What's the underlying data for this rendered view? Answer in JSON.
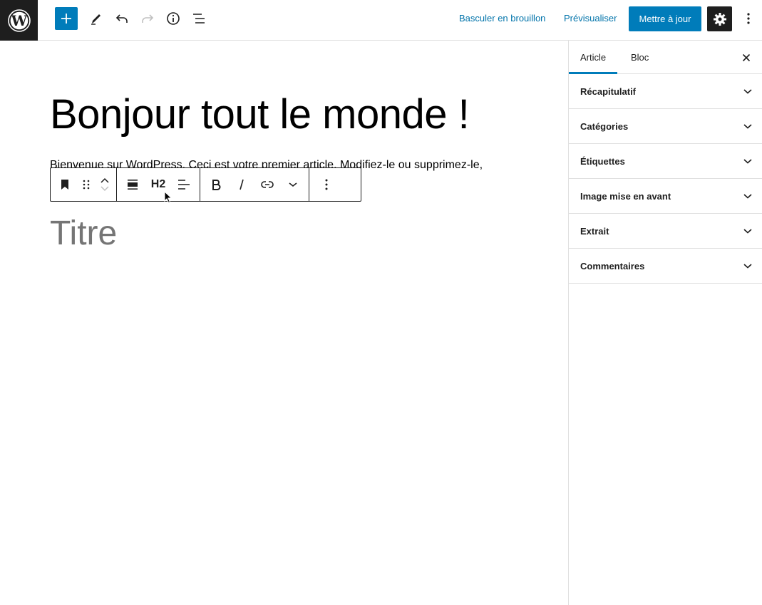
{
  "topbar": {
    "switch_draft_label": "Basculer en brouillon",
    "preview_label": "Prévisualiser",
    "update_label": "Mettre à jour",
    "icons": [
      "wordpress-logo",
      "plus-icon",
      "pencil-icon",
      "undo-icon",
      "redo-icon",
      "info-icon",
      "list-view-icon",
      "gear-icon",
      "more-vertical-icon"
    ]
  },
  "editor": {
    "post_title": "Bonjour tout le monde !",
    "paragraph": "Bienvenue sur WordPress. Ceci est votre premier article. Modifiez-le ou supprimez-le,",
    "heading_placeholder": "Titre",
    "toolbar": {
      "heading_level": "H2",
      "icons": [
        "bookmark-icon",
        "drag-handle-icon",
        "move-up-icon",
        "move-down-icon",
        "align-wide-icon",
        "text-align-left-icon",
        "bold-icon",
        "italic-icon",
        "link-icon",
        "chevron-down-icon",
        "more-options-icon"
      ]
    }
  },
  "sidebar": {
    "tabs": [
      {
        "label": "Article",
        "active": true
      },
      {
        "label": "Bloc",
        "active": false
      }
    ],
    "panels": [
      {
        "label": "Récapitulatif"
      },
      {
        "label": "Catégories"
      },
      {
        "label": "Étiquettes"
      },
      {
        "label": "Image mise en avant"
      },
      {
        "label": "Extrait"
      },
      {
        "label": "Commentaires"
      }
    ]
  },
  "colors": {
    "accent": "#007cba",
    "dark": "#1e1e1e",
    "link": "#0073aa",
    "placeholder": "#757575"
  }
}
